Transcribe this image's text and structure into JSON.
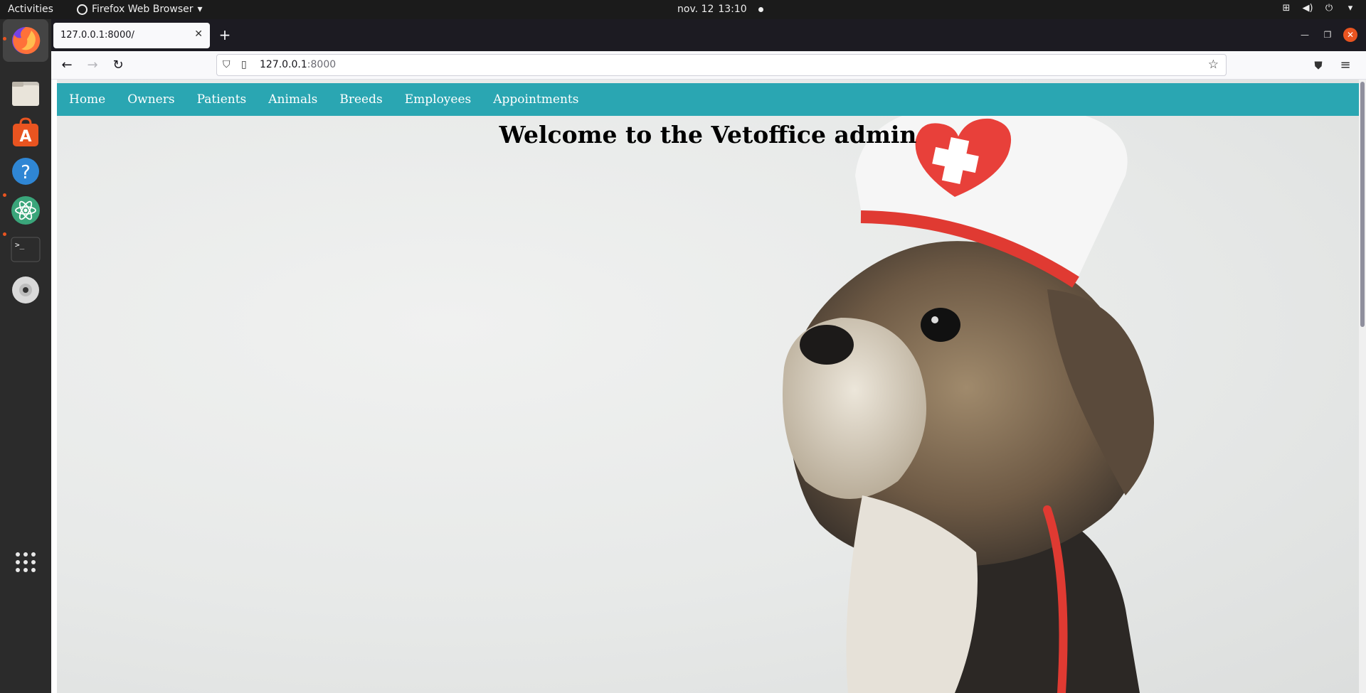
{
  "topbar": {
    "activities": "Activities",
    "app_name": "Firefox Web Browser",
    "date": "nov. 12",
    "time": "13:10"
  },
  "dock": {
    "apps": [
      "firefox-icon",
      "files-icon",
      "software-icon",
      "help-icon",
      "atom-icon",
      "terminal-icon",
      "disc-icon",
      "app-grid-icon"
    ]
  },
  "browser": {
    "tab_title": "127.0.0.1:8000/",
    "url_host": "127.0.0.1",
    "url_port": ":8000"
  },
  "page": {
    "menu": [
      "Home",
      "Owners",
      "Patients",
      "Animals",
      "Breeds",
      "Employees",
      "Appointments"
    ],
    "heading": "Welcome to the Vetoffice admin"
  },
  "colors": {
    "menu_bg": "#2aa6b2",
    "accent_orange": "#e95420"
  }
}
